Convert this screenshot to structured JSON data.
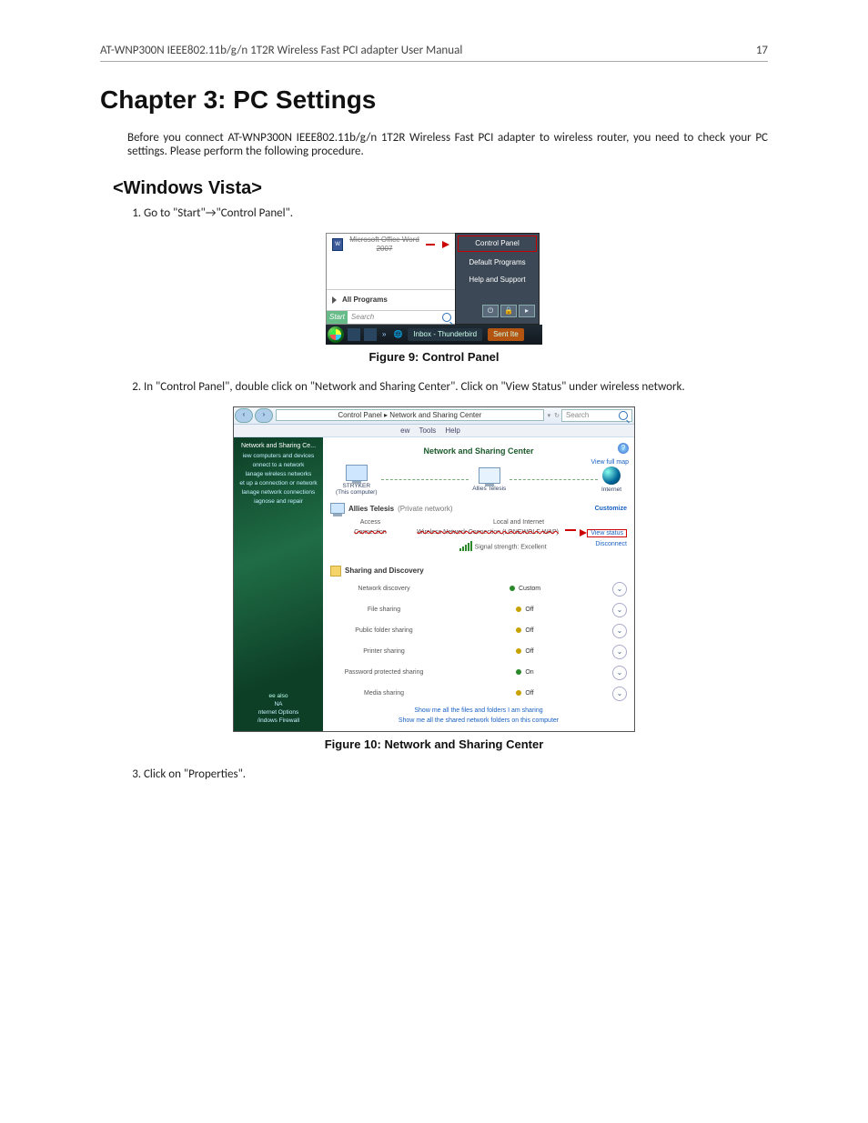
{
  "header": {
    "title": "AT-WNP300N IEEE802.11b/g/n 1T2R Wireless Fast PCI adapter User Manual",
    "page": "17"
  },
  "chapter_title": "Chapter 3: PC Settings",
  "intro": "Before you connect AT-WNP300N IEEE802.11b/g/n 1T2R Wireless Fast PCI adapter to wireless router, you need to check your PC settings. Please perform the following procedure.",
  "subhead": "<Windows Vista>",
  "steps": {
    "s1": "Go to \"Start\"→\"Control Panel\".",
    "s2": "In \"Control Panel\", double click on \"Network and Sharing Center\". Click on \"View Status\" under wireless network.",
    "s3": "Click on \"Properties\"."
  },
  "fig1": {
    "caption": "Figure 9: Control Panel",
    "left": {
      "pinned": "Microsoft Office Word 2007",
      "all_programs": "All Programs",
      "start_label": "Start",
      "search_placeholder": "Search"
    },
    "right": {
      "control_panel": "Control Panel",
      "default_programs": "Default Programs",
      "help_support": "Help and Support",
      "power": "⏻",
      "lock": "🔒",
      "more": "▸"
    },
    "taskbar": {
      "inbox": "Inbox - Thunderbird",
      "sent": "Sent Ite"
    }
  },
  "fig2": {
    "caption": "Figure 10: Network and Sharing Center",
    "crumb": "Control Panel  ▸  Network and Sharing Center",
    "search": "Search",
    "menubar": {
      "ew": "ew",
      "tools": "Tools",
      "help": "Help"
    },
    "sidebar": {
      "header": "Network and Sharing Ce...",
      "tasks": {
        "t1": "iew computers and devices",
        "t2": "onnect to a network",
        "t3": "lanage wireless networks",
        "t4": "et up a connection or network",
        "t5": "lanage network connections",
        "t6": "iagnose and repair"
      },
      "see_also_label": "ee also",
      "see1": "NA",
      "see2": "nternet Options",
      "see3": "/indows Firewall"
    },
    "main": {
      "title": "Network and Sharing Center",
      "view_full_map": "View full map",
      "node1": "STRYKER",
      "node1b": "(This computer)",
      "node2": "Allies Telesis",
      "node3": "Internet",
      "net_name": "Allies Telesis",
      "net_type": "(Private network)",
      "customize": "Customize",
      "access_k": "Access",
      "access_v": "Local and Internet",
      "conn_k": "Connection",
      "conn_v": "Wireless Network Connection (LONEWOLF-WAP)",
      "view_status": "View status",
      "disconnect": "Disconnect",
      "signal_label": "Signal strength: Excellent",
      "sharing_title": "Sharing and Discovery",
      "rows": {
        "r1": {
          "name": "Network discovery",
          "state": "Custom",
          "on": true
        },
        "r2": {
          "name": "File sharing",
          "state": "Off",
          "on": false
        },
        "r3": {
          "name": "Public folder sharing",
          "state": "Off",
          "on": false
        },
        "r4": {
          "name": "Printer sharing",
          "state": "Off",
          "on": false
        },
        "r5": {
          "name": "Password protected sharing",
          "state": "On",
          "on": true
        },
        "r6": {
          "name": "Media sharing",
          "state": "Off",
          "on": false
        }
      },
      "link1": "Show me all the files and folders I am sharing",
      "link2": "Show me all the shared network folders on this computer"
    }
  }
}
